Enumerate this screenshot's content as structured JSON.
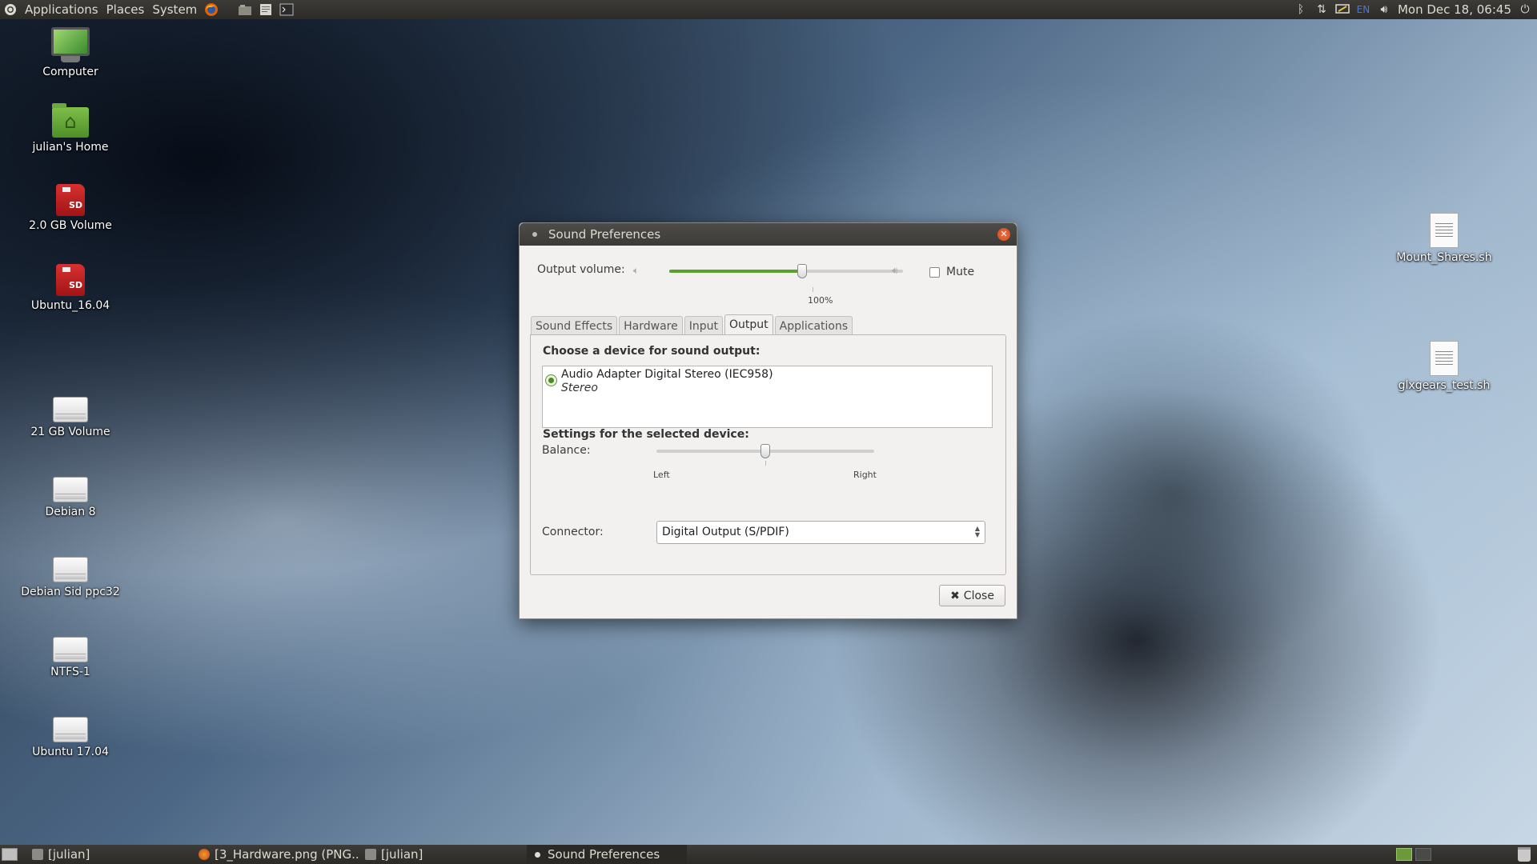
{
  "top_panel": {
    "menus": [
      "Applications",
      "Places",
      "System"
    ],
    "clock": "Mon Dec 18, 06:45",
    "keyboard_indicator": "EN"
  },
  "desktop_icons": [
    {
      "label": "Computer",
      "icon": "computer-icon"
    },
    {
      "label": "julian's Home",
      "icon": "home-folder-icon"
    },
    {
      "label": "2.0 GB Volume",
      "icon": "sd-card-icon"
    },
    {
      "label": "Ubuntu_16.04",
      "icon": "sd-card-icon"
    },
    {
      "label": "21 GB Volume",
      "icon": "drive-icon"
    },
    {
      "label": "Debian 8",
      "icon": "drive-icon"
    },
    {
      "label": "Debian Sid ppc32",
      "icon": "drive-icon"
    },
    {
      "label": "NTFS-1",
      "icon": "drive-icon"
    },
    {
      "label": "Ubuntu 17.04",
      "icon": "drive-icon"
    },
    {
      "label": "Mount_Shares.sh",
      "icon": "script-file-icon"
    },
    {
      "label": "glxgears_test.sh",
      "icon": "script-file-icon"
    }
  ],
  "dialog": {
    "title": "Sound Preferences",
    "output_volume_label": "Output volume:",
    "volume_percent_text": "100%",
    "volume_level": 0.57,
    "mute_label": "Mute",
    "mute_checked": false,
    "tabs": [
      "Sound Effects",
      "Hardware",
      "Input",
      "Output",
      "Applications"
    ],
    "active_tab": "Output",
    "choose_device_label": "Choose a device for sound output:",
    "device": {
      "name": "Audio Adapter Digital Stereo (IEC958)",
      "profile": "Stereo"
    },
    "settings_label": "Settings for the selected device:",
    "balance_label": "Balance:",
    "balance_left": "Left",
    "balance_right": "Right",
    "balance_value": 0.5,
    "connector_label": "Connector:",
    "connector_value": "Digital Output (S/PDIF)",
    "close_label": "Close"
  },
  "bottom_panel": {
    "tasks": [
      "[julian]",
      "[3_Hardware.png (PNG...",
      "[julian]",
      "Sound Preferences"
    ]
  },
  "colors": {
    "panel": "#3c3b37",
    "slider_fill": "#5aa02c",
    "close_button": "#e0531f"
  }
}
